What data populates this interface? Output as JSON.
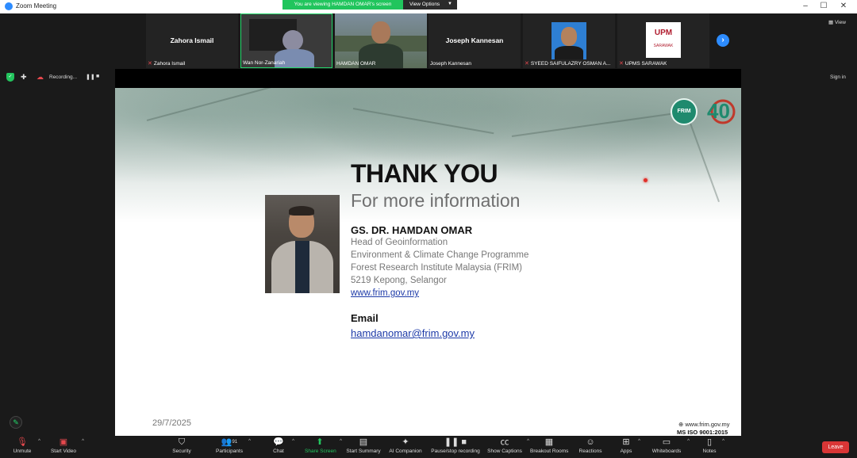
{
  "window": {
    "title": "Zoom Meeting"
  },
  "banner": {
    "text": "You are viewing HAMDAN OMAR's screen",
    "view_options": "View Options"
  },
  "gallery": {
    "tiles": [
      {
        "center_name": "Zahora Ismail",
        "label": "Zahora Ismail",
        "muted": true
      },
      {
        "center_name": "",
        "label": "Wan Nor-Zanariah",
        "muted": false,
        "active": true
      },
      {
        "center_name": "",
        "label": "HAMDAN OMAR",
        "muted": false
      },
      {
        "center_name": "Joseph Kannesan",
        "label": "Joseph Kannesan",
        "muted": false
      },
      {
        "center_name": "",
        "label": "SYEED SAIFULAZRY OSMAN A...",
        "muted": true
      },
      {
        "center_name": "",
        "label": "UPMS SARAWAK",
        "muted": true
      }
    ],
    "upm_logo_text": "UPM",
    "upm_logo_sub": "SARAWAK"
  },
  "top_right": {
    "view": "View",
    "sign_in": "Sign in"
  },
  "status": {
    "recording": "Recording..."
  },
  "slide": {
    "heading": "THANK YOU",
    "subheading": "For more information",
    "name": "GS. DR. HAMDAN OMAR",
    "lines": [
      "Head of Geoinformation",
      "Environment & Climate Change Programme",
      "Forest Research Institute Malaysia (FRIM)",
      "5219 Kepong, Selangor"
    ],
    "website": "www.frim.gov.my",
    "email_label": "Email",
    "email": "hamdanomar@frim.gov.my",
    "date": "29/7/2025",
    "footer_web": "www.frim.gov.my",
    "footer_iso": "MS ISO 9001:2015",
    "frim_logo_text": "FRIM",
    "anniversary_text": "40"
  },
  "toolbar": {
    "unmute": "Unmute",
    "start_video": "Start Video",
    "security": "Security",
    "participants": "Participants",
    "participants_count": "91",
    "chat": "Chat",
    "share_screen": "Share Screen",
    "start_summary": "Start Summary",
    "ai_companion": "AI Companion",
    "pause_recording": "Pause/stop recording",
    "show_captions": "Show Captions",
    "breakout_rooms": "Breakout Rooms",
    "reactions": "Reactions",
    "apps": "Apps",
    "whiteboards": "Whiteboards",
    "notes": "Notes",
    "leave": "Leave"
  },
  "colors": {
    "accent": "#2d8cff",
    "green": "#21c55d",
    "leave": "#d93636",
    "link": "#1d3aa8"
  }
}
